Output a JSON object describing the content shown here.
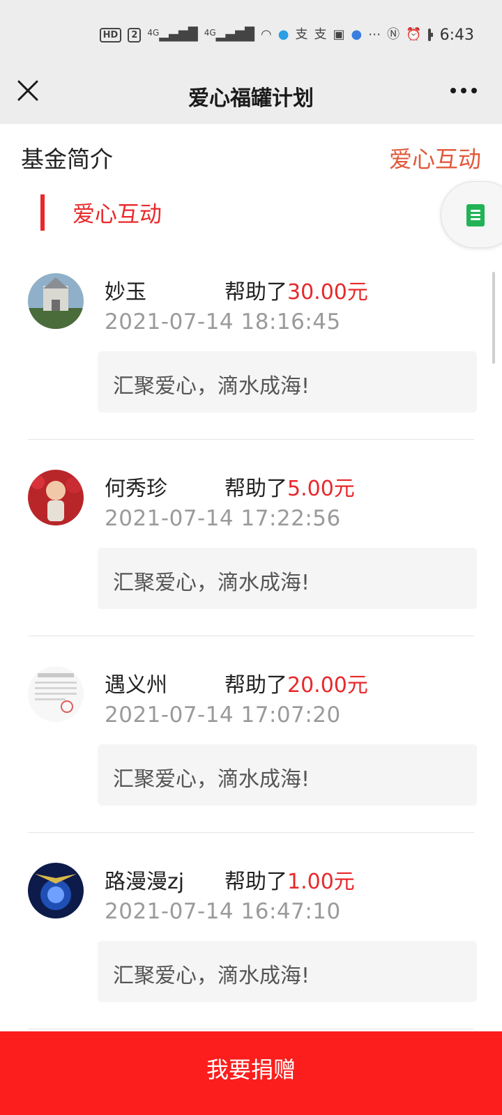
{
  "status_bar": {
    "hd_label": "HD",
    "sim_label": "2",
    "network_1": "4G",
    "network_2": "4G",
    "time": "6:43"
  },
  "nav": {
    "title": "爱心福罐计划"
  },
  "tabs": {
    "left": "基金简介",
    "right": "爱心互动"
  },
  "section": {
    "title": "爱心互动"
  },
  "colors": {
    "accent_red": "#e8282b",
    "tab_active": "#e0593b",
    "donate_bg": "#fb1e1c",
    "doc_icon": "#21b355"
  },
  "donations": [
    {
      "name": "妙玉",
      "helped_label": "帮助了",
      "amount": "30.00元",
      "time": "2021-07-14 18:16:45",
      "message": "汇聚爱心，滴水成海!"
    },
    {
      "name": "何秀珍",
      "helped_label": "帮助了",
      "amount": "5.00元",
      "time": "2021-07-14 17:22:56",
      "message": "汇聚爱心，滴水成海!"
    },
    {
      "name": "遇义州",
      "helped_label": "帮助了",
      "amount": "20.00元",
      "time": "2021-07-14 17:07:20",
      "message": "汇聚爱心，滴水成海!"
    },
    {
      "name": "路漫漫zj",
      "helped_label": "帮助了",
      "amount": "1.00元",
      "time": "2021-07-14 16:47:10",
      "message": "汇聚爱心，滴水成海!"
    },
    {
      "name": "",
      "helped_label": "",
      "amount": "",
      "time": "",
      "message": ""
    }
  ],
  "donate_button": {
    "label": "我要捐赠"
  }
}
